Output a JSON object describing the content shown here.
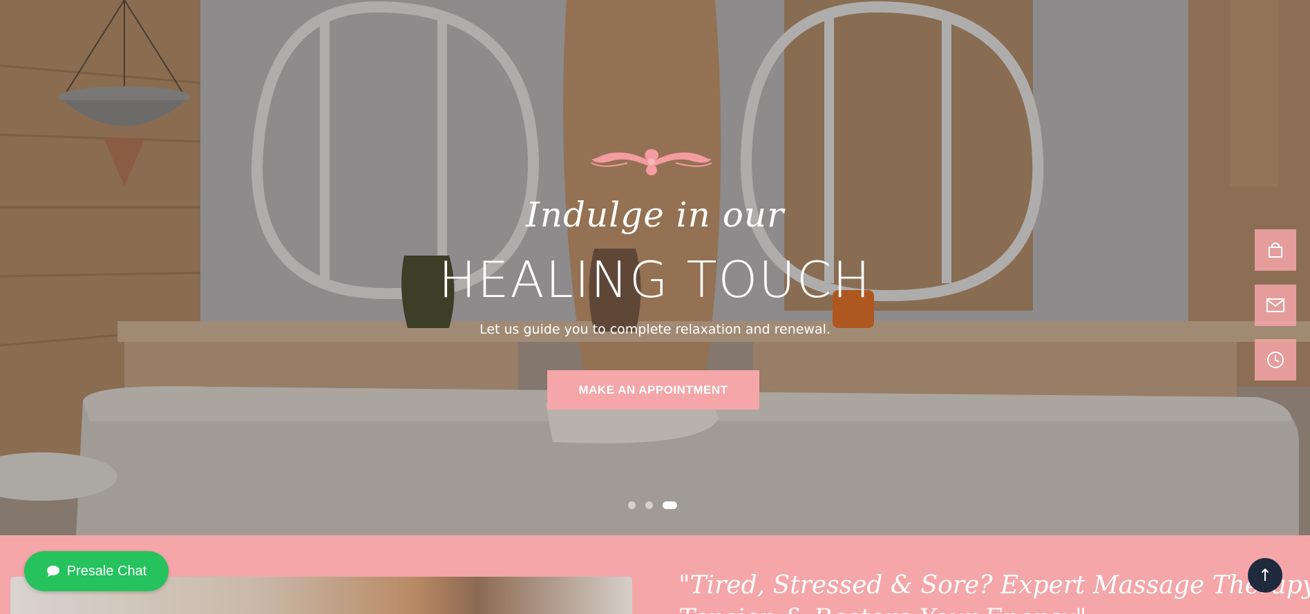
{
  "hero": {
    "script_text": "Indulge in our",
    "title": "HEALING TOUCH",
    "subtitle": "Let us guide you to complete relaxation and renewal.",
    "cta_label": "MAKE AN APPOINTMENT",
    "slides": {
      "count": 3,
      "active_index": 2
    }
  },
  "side_buttons": [
    {
      "icon": "shopping-bag-icon"
    },
    {
      "icon": "envelope-icon"
    },
    {
      "icon": "clock-icon"
    }
  ],
  "section2": {
    "tagline_line1": "\"Tired, Stressed & Sore? Expert Massage Therapy to Melt Away",
    "tagline_line2": "Tension & Restore Your Energy\""
  },
  "presale_chat": {
    "label": "Presale Chat",
    "icon": "chat-bubble-icon"
  },
  "back_to_top": {
    "icon": "arrow-up-icon",
    "glyph": "↑"
  },
  "colors": {
    "accent": "#f4a6a9",
    "chat_green": "#25c25e",
    "to_top_bg": "#1f2a3c"
  }
}
